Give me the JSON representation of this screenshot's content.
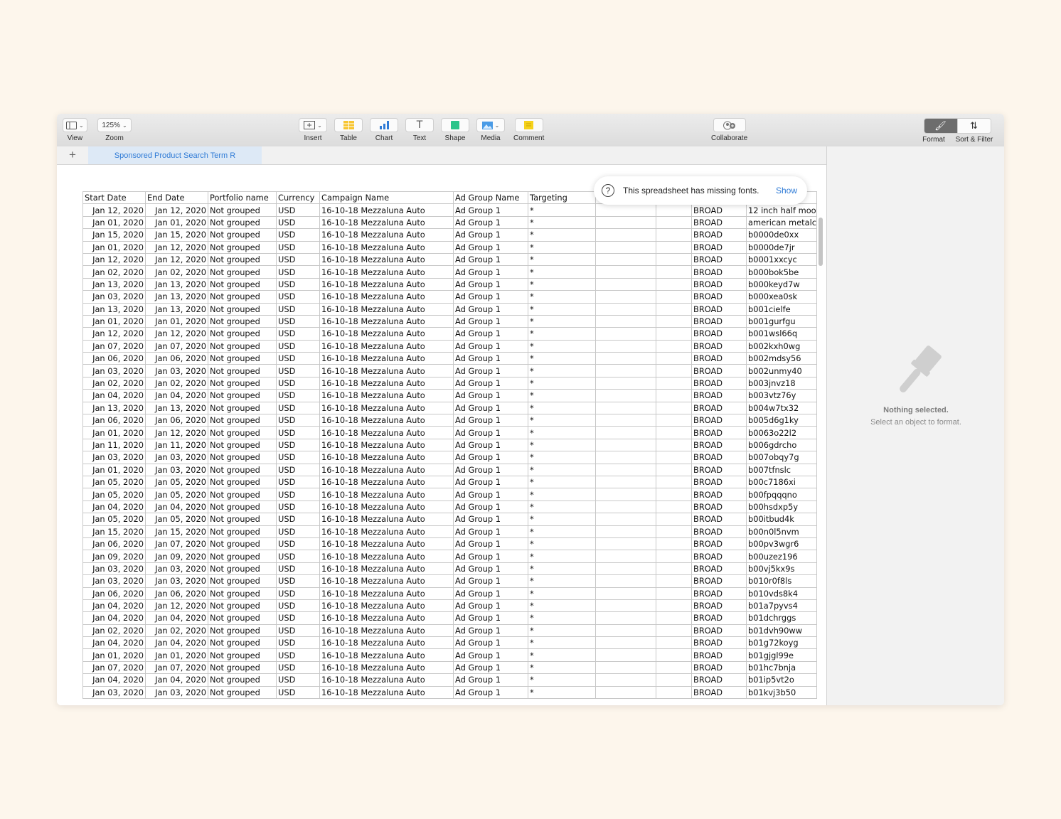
{
  "toolbar": {
    "view_label": "View",
    "zoom_value": "125%",
    "zoom_label": "Zoom",
    "insert_label": "Insert",
    "table_label": "Table",
    "chart_label": "Chart",
    "text_label": "Text",
    "shape_label": "Shape",
    "media_label": "Media",
    "comment_label": "Comment",
    "collaborate_label": "Collaborate",
    "format_label": "Format",
    "sort_filter_label": "Sort & Filter"
  },
  "sheet_tab": {
    "label": "Sponsored Product Search Term R"
  },
  "toast": {
    "message": "This spreadsheet has missing fonts.",
    "action": "Show"
  },
  "sidebar": {
    "nothing_selected": "Nothing selected.",
    "hint": "Select an object to format."
  },
  "colors": {
    "accent": "#2f7bd6",
    "tab_bg": "#dde9f6",
    "shape_green": "#2bc48a",
    "table_yellow": "#f7c531",
    "comment_yellow": "#f6d21c"
  },
  "table": {
    "headers": [
      "Start Date",
      "End Date",
      "Portfolio name",
      "Currency",
      "Campaign Name",
      "Ad Group Name",
      "Targeting",
      "",
      "",
      "",
      ""
    ],
    "rows": [
      [
        "Jan 12, 2020",
        "Jan 12, 2020",
        "Not grouped",
        "USD",
        "16-10-18 Mezzaluna Auto",
        "Ad Group 1",
        "*",
        "",
        "",
        "BROAD",
        "12 inch half moo"
      ],
      [
        "Jan 01, 2020",
        "Jan 01, 2020",
        "Not grouped",
        "USD",
        "16-10-18 Mezzaluna Auto",
        "Ad Group 1",
        "*",
        "",
        "",
        "BROAD",
        "american metalc"
      ],
      [
        "Jan 15, 2020",
        "Jan 15, 2020",
        "Not grouped",
        "USD",
        "16-10-18 Mezzaluna Auto",
        "Ad Group 1",
        "*",
        "",
        "",
        "BROAD",
        "b0000de0xx"
      ],
      [
        "Jan 01, 2020",
        "Jan 12, 2020",
        "Not grouped",
        "USD",
        "16-10-18 Mezzaluna Auto",
        "Ad Group 1",
        "*",
        "",
        "",
        "BROAD",
        "b0000de7jr"
      ],
      [
        "Jan 12, 2020",
        "Jan 12, 2020",
        "Not grouped",
        "USD",
        "16-10-18 Mezzaluna Auto",
        "Ad Group 1",
        "*",
        "",
        "",
        "BROAD",
        "b0001xxcyc"
      ],
      [
        "Jan 02, 2020",
        "Jan 02, 2020",
        "Not grouped",
        "USD",
        "16-10-18 Mezzaluna Auto",
        "Ad Group 1",
        "*",
        "",
        "",
        "BROAD",
        "b000bok5be"
      ],
      [
        "Jan 13, 2020",
        "Jan 13, 2020",
        "Not grouped",
        "USD",
        "16-10-18 Mezzaluna Auto",
        "Ad Group 1",
        "*",
        "",
        "",
        "BROAD",
        "b000keyd7w"
      ],
      [
        "Jan 03, 2020",
        "Jan 13, 2020",
        "Not grouped",
        "USD",
        "16-10-18 Mezzaluna Auto",
        "Ad Group 1",
        "*",
        "",
        "",
        "BROAD",
        "b000xea0sk"
      ],
      [
        "Jan 13, 2020",
        "Jan 13, 2020",
        "Not grouped",
        "USD",
        "16-10-18 Mezzaluna Auto",
        "Ad Group 1",
        "*",
        "",
        "",
        "BROAD",
        "b001cielfe"
      ],
      [
        "Jan 01, 2020",
        "Jan 01, 2020",
        "Not grouped",
        "USD",
        "16-10-18 Mezzaluna Auto",
        "Ad Group 1",
        "*",
        "",
        "",
        "BROAD",
        "b001gurfgu"
      ],
      [
        "Jan 12, 2020",
        "Jan 12, 2020",
        "Not grouped",
        "USD",
        "16-10-18 Mezzaluna Auto",
        "Ad Group 1",
        "*",
        "",
        "",
        "BROAD",
        "b001wsl66q"
      ],
      [
        "Jan 07, 2020",
        "Jan 07, 2020",
        "Not grouped",
        "USD",
        "16-10-18 Mezzaluna Auto",
        "Ad Group 1",
        "*",
        "",
        "",
        "BROAD",
        "b002kxh0wg"
      ],
      [
        "Jan 06, 2020",
        "Jan 06, 2020",
        "Not grouped",
        "USD",
        "16-10-18 Mezzaluna Auto",
        "Ad Group 1",
        "*",
        "",
        "",
        "BROAD",
        "b002mdsy56"
      ],
      [
        "Jan 03, 2020",
        "Jan 03, 2020",
        "Not grouped",
        "USD",
        "16-10-18 Mezzaluna Auto",
        "Ad Group 1",
        "*",
        "",
        "",
        "BROAD",
        "b002unmy40"
      ],
      [
        "Jan 02, 2020",
        "Jan 02, 2020",
        "Not grouped",
        "USD",
        "16-10-18 Mezzaluna Auto",
        "Ad Group 1",
        "*",
        "",
        "",
        "BROAD",
        "b003jnvz18"
      ],
      [
        "Jan 04, 2020",
        "Jan 04, 2020",
        "Not grouped",
        "USD",
        "16-10-18 Mezzaluna Auto",
        "Ad Group 1",
        "*",
        "",
        "",
        "BROAD",
        "b003vtz76y"
      ],
      [
        "Jan 13, 2020",
        "Jan 13, 2020",
        "Not grouped",
        "USD",
        "16-10-18 Mezzaluna Auto",
        "Ad Group 1",
        "*",
        "",
        "",
        "BROAD",
        "b004w7tx32"
      ],
      [
        "Jan 06, 2020",
        "Jan 06, 2020",
        "Not grouped",
        "USD",
        "16-10-18 Mezzaluna Auto",
        "Ad Group 1",
        "*",
        "",
        "",
        "BROAD",
        "b005d6g1ky"
      ],
      [
        "Jan 01, 2020",
        "Jan 12, 2020",
        "Not grouped",
        "USD",
        "16-10-18 Mezzaluna Auto",
        "Ad Group 1",
        "*",
        "",
        "",
        "BROAD",
        "b0063o22l2"
      ],
      [
        "Jan 11, 2020",
        "Jan 11, 2020",
        "Not grouped",
        "USD",
        "16-10-18 Mezzaluna Auto",
        "Ad Group 1",
        "*",
        "",
        "",
        "BROAD",
        "b006gdrcho"
      ],
      [
        "Jan 03, 2020",
        "Jan 03, 2020",
        "Not grouped",
        "USD",
        "16-10-18 Mezzaluna Auto",
        "Ad Group 1",
        "*",
        "",
        "",
        "BROAD",
        "b007obqy7g"
      ],
      [
        "Jan 01, 2020",
        "Jan 03, 2020",
        "Not grouped",
        "USD",
        "16-10-18 Mezzaluna Auto",
        "Ad Group 1",
        "*",
        "",
        "",
        "BROAD",
        "b007tfnslc"
      ],
      [
        "Jan 05, 2020",
        "Jan 05, 2020",
        "Not grouped",
        "USD",
        "16-10-18 Mezzaluna Auto",
        "Ad Group 1",
        "*",
        "",
        "",
        "BROAD",
        "b00c7186xi"
      ],
      [
        "Jan 05, 2020",
        "Jan 05, 2020",
        "Not grouped",
        "USD",
        "16-10-18 Mezzaluna Auto",
        "Ad Group 1",
        "*",
        "",
        "",
        "BROAD",
        "b00fpqqqno"
      ],
      [
        "Jan 04, 2020",
        "Jan 04, 2020",
        "Not grouped",
        "USD",
        "16-10-18 Mezzaluna Auto",
        "Ad Group 1",
        "*",
        "",
        "",
        "BROAD",
        "b00hsdxp5y"
      ],
      [
        "Jan 05, 2020",
        "Jan 05, 2020",
        "Not grouped",
        "USD",
        "16-10-18 Mezzaluna Auto",
        "Ad Group 1",
        "*",
        "",
        "",
        "BROAD",
        "b00itbud4k"
      ],
      [
        "Jan 15, 2020",
        "Jan 15, 2020",
        "Not grouped",
        "USD",
        "16-10-18 Mezzaluna Auto",
        "Ad Group 1",
        "*",
        "",
        "",
        "BROAD",
        "b00n0l5nvm"
      ],
      [
        "Jan 06, 2020",
        "Jan 07, 2020",
        "Not grouped",
        "USD",
        "16-10-18 Mezzaluna Auto",
        "Ad Group 1",
        "*",
        "",
        "",
        "BROAD",
        "b00pv3wgr6"
      ],
      [
        "Jan 09, 2020",
        "Jan 09, 2020",
        "Not grouped",
        "USD",
        "16-10-18 Mezzaluna Auto",
        "Ad Group 1",
        "*",
        "",
        "",
        "BROAD",
        "b00uzez196"
      ],
      [
        "Jan 03, 2020",
        "Jan 03, 2020",
        "Not grouped",
        "USD",
        "16-10-18 Mezzaluna Auto",
        "Ad Group 1",
        "*",
        "",
        "",
        "BROAD",
        "b00vj5kx9s"
      ],
      [
        "Jan 03, 2020",
        "Jan 03, 2020",
        "Not grouped",
        "USD",
        "16-10-18 Mezzaluna Auto",
        "Ad Group 1",
        "*",
        "",
        "",
        "BROAD",
        "b010r0f8ls"
      ],
      [
        "Jan 06, 2020",
        "Jan 06, 2020",
        "Not grouped",
        "USD",
        "16-10-18 Mezzaluna Auto",
        "Ad Group 1",
        "*",
        "",
        "",
        "BROAD",
        "b010vds8k4"
      ],
      [
        "Jan 04, 2020",
        "Jan 12, 2020",
        "Not grouped",
        "USD",
        "16-10-18 Mezzaluna Auto",
        "Ad Group 1",
        "*",
        "",
        "",
        "BROAD",
        "b01a7pyvs4"
      ],
      [
        "Jan 04, 2020",
        "Jan 04, 2020",
        "Not grouped",
        "USD",
        "16-10-18 Mezzaluna Auto",
        "Ad Group 1",
        "*",
        "",
        "",
        "BROAD",
        "b01dchrggs"
      ],
      [
        "Jan 02, 2020",
        "Jan 02, 2020",
        "Not grouped",
        "USD",
        "16-10-18 Mezzaluna Auto",
        "Ad Group 1",
        "*",
        "",
        "",
        "BROAD",
        "b01dvh90ww"
      ],
      [
        "Jan 04, 2020",
        "Jan 04, 2020",
        "Not grouped",
        "USD",
        "16-10-18 Mezzaluna Auto",
        "Ad Group 1",
        "*",
        "",
        "",
        "BROAD",
        "b01g72koyg"
      ],
      [
        "Jan 01, 2020",
        "Jan 01, 2020",
        "Not grouped",
        "USD",
        "16-10-18 Mezzaluna Auto",
        "Ad Group 1",
        "*",
        "",
        "",
        "BROAD",
        "b01gjgl99e"
      ],
      [
        "Jan 07, 2020",
        "Jan 07, 2020",
        "Not grouped",
        "USD",
        "16-10-18 Mezzaluna Auto",
        "Ad Group 1",
        "*",
        "",
        "",
        "BROAD",
        "b01hc7bnja"
      ],
      [
        "Jan 04, 2020",
        "Jan 04, 2020",
        "Not grouped",
        "USD",
        "16-10-18 Mezzaluna Auto",
        "Ad Group 1",
        "*",
        "",
        "",
        "BROAD",
        "b01ip5vt2o"
      ],
      [
        "Jan 03, 2020",
        "Jan 03, 2020",
        "Not grouped",
        "USD",
        "16-10-18 Mezzaluna Auto",
        "Ad Group 1",
        "*",
        "",
        "",
        "BROAD",
        "b01kvj3b50"
      ]
    ]
  }
}
